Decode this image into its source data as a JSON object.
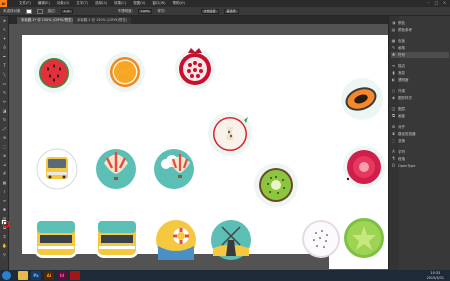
{
  "app": {
    "logo": "Ai",
    "menus": [
      "文件(F)",
      "编辑(E)",
      "对象(O)",
      "文字(T)",
      "选择(S)",
      "效果(C)",
      "视图(V)",
      "窗口(W)",
      "帮助(H)"
    ],
    "window_controls": [
      "minimize-icon",
      "maximize-icon",
      "close-icon"
    ]
  },
  "control": {
    "selection_label": "未选择对象",
    "stroke_label": "描边:",
    "stroke_value": "1 pt",
    "style_label": "样式:",
    "opacity_label": "不透明度:",
    "opacity_value": "100%",
    "doc_setup": "文档设置",
    "prefs": "首选项"
  },
  "tabs": [
    {
      "label": "未标题-1* @ 150% (CMYK/预览)",
      "active": true
    },
    {
      "label": "未标题-2 @ 150% (CMYK/预览)",
      "active": false
    }
  ],
  "tools": [
    "selection-icon",
    "direct-select-icon",
    "magic-wand-icon",
    "lasso-icon",
    "pen-icon",
    "type-icon",
    "line-icon",
    "rectangle-icon",
    "paintbrush-icon",
    "pencil-icon",
    "eraser-icon",
    "rotate-icon",
    "scale-icon",
    "warp-icon",
    "free-transform-icon",
    "shape-builder-icon",
    "perspective-icon",
    "mesh-icon",
    "gradient-icon",
    "eyedropper-icon",
    "blend-icon",
    "symbol-sprayer-icon",
    "column-graph-icon",
    "artboard-icon",
    "slice-icon",
    "hand-icon",
    "zoom-icon"
  ],
  "panels": [
    {
      "icon": "color-icon",
      "label": "颜色"
    },
    {
      "icon": "color-guide-icon",
      "label": "颜色参考"
    },
    {
      "icon": "swatches-icon",
      "label": "色板"
    },
    {
      "icon": "brushes-icon",
      "label": "画笔"
    },
    {
      "icon": "symbols-icon",
      "label": "符号"
    },
    {
      "icon": "stroke-icon",
      "label": "描边"
    },
    {
      "icon": "gradient-icon",
      "label": "渐变"
    },
    {
      "icon": "transparency-icon",
      "label": "透明度"
    },
    {
      "icon": "appearance-icon",
      "label": "外观"
    },
    {
      "icon": "graphic-styles-icon",
      "label": "图形样式"
    },
    {
      "icon": "layers-icon",
      "label": "图层"
    },
    {
      "icon": "artboards-icon",
      "label": "画板"
    },
    {
      "icon": "align-icon",
      "label": "对齐"
    },
    {
      "icon": "pathfinder-icon",
      "label": "路径查找器"
    },
    {
      "icon": "transform-icon",
      "label": "变换"
    },
    {
      "icon": "character-icon",
      "label": "字符"
    },
    {
      "icon": "paragraph-icon",
      "label": "段落"
    },
    {
      "icon": "opentype-icon",
      "label": "OpenType"
    }
  ],
  "panel_selected_index": 2,
  "artwork": [
    "watermelon-icon",
    "orange-icon",
    "pomegranate-icon",
    "apple-icon",
    "papaya-icon",
    "bus-icon",
    "hot-air-balloon-icon",
    "kiwi-icon",
    "dragonfruit-icon",
    "school-bus-icon",
    "lifebuoy-icon",
    "windmill-icon",
    "starfruit-icon"
  ],
  "taskbar": {
    "apps": [
      {
        "icon": "explorer-icon",
        "label": "",
        "color": "#e8b84a"
      },
      {
        "icon": "photoshop-icon",
        "label": "Ps",
        "color": "#1a3a66"
      },
      {
        "icon": "illustrator-icon",
        "label": "Ai",
        "color": "#4a2a08"
      },
      {
        "icon": "indesign-icon",
        "label": "Id",
        "color": "#5a0f3a"
      },
      {
        "icon": "acrobat-icon",
        "label": "",
        "color": "#a01818"
      }
    ],
    "time": "10:33",
    "date": "2015/3/31"
  },
  "colors": {
    "accent": "#ff7f18",
    "canvas": "#535353",
    "panel": "#383838"
  }
}
